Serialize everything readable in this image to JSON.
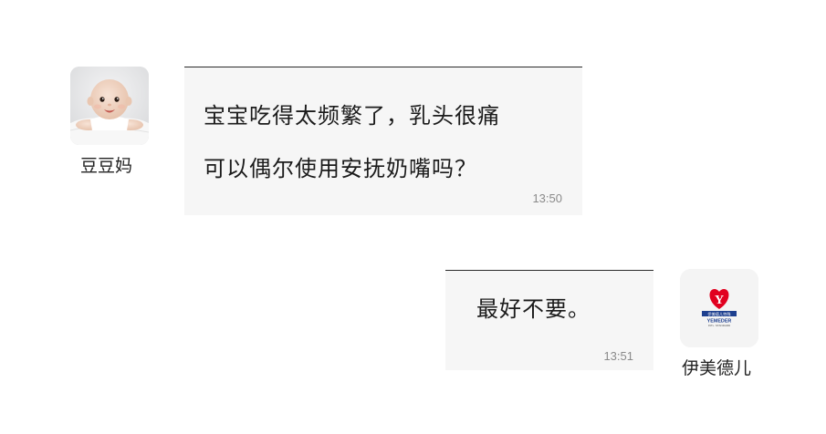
{
  "chat": {
    "messages": [
      {
        "sender": "豆豆妈",
        "text": "宝宝吃得太频繁了，乳头很痛\n可以偶尔使用安抚奶嘴吗？",
        "time": "13:50"
      },
      {
        "sender": "伊美德儿",
        "text": "最好不要。",
        "time": "13:51"
      }
    ]
  },
  "brand": {
    "logo_letter": "Y",
    "logo_banner": "伊美德儿特殊",
    "logo_name": "YEMEDER",
    "logo_sub": "INTL. STANDARD",
    "primary_color": "#e1001f",
    "banner_color": "#1d3f8f"
  },
  "icons": {
    "left_avatar": "baby-photo-avatar",
    "right_avatar": "yemeder-logo-avatar"
  }
}
